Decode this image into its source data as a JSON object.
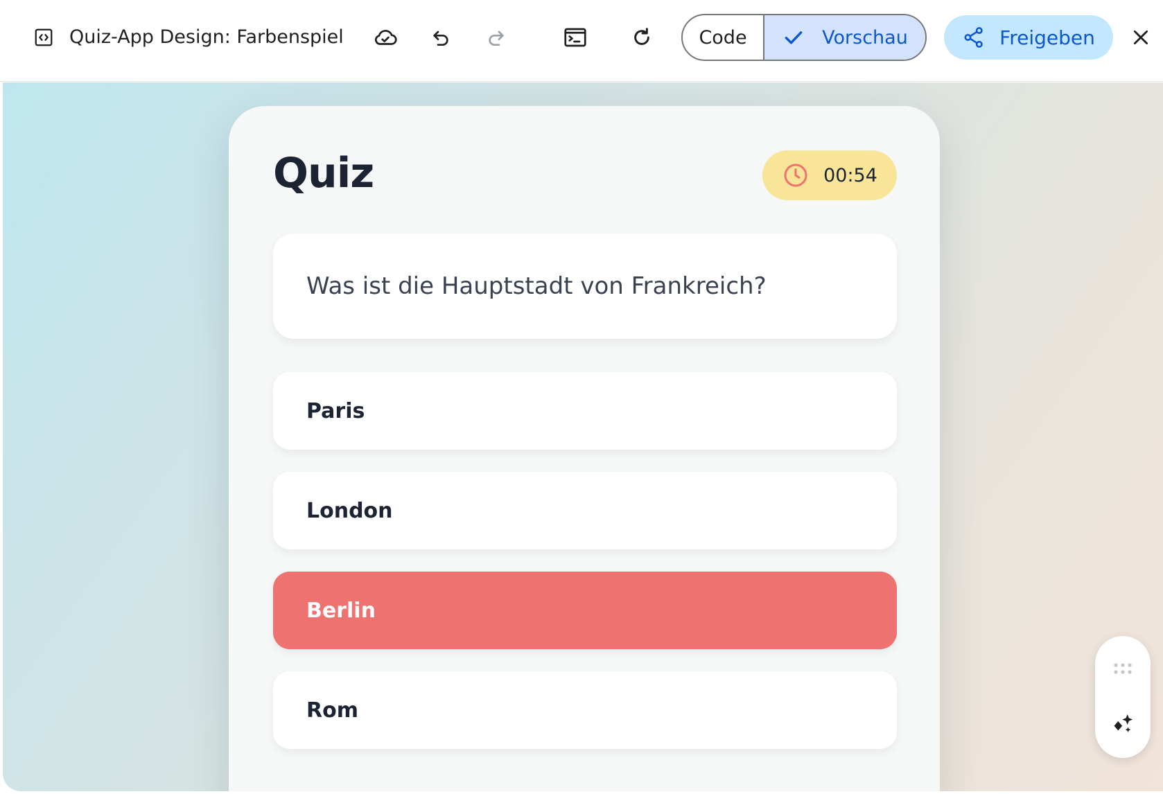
{
  "toolbar": {
    "app_icon": "code-file-icon",
    "title": "Quiz-App Design: Farbenspiel",
    "cloud_icon": "cloud-check-icon",
    "undo_icon": "undo-icon",
    "redo_icon": "redo-icon",
    "terminal_icon": "terminal-icon",
    "refresh_icon": "refresh-icon",
    "view_toggle": {
      "code_label": "Code",
      "preview_label": "Vorschau",
      "selected": "Vorschau"
    },
    "share_label": "Freigeben",
    "share_icon": "share-icon",
    "close_icon": "close-icon"
  },
  "quiz": {
    "title": "Quiz",
    "timer": "00:54",
    "timer_icon": "clock-icon",
    "question": "Was ist die Hauptstadt von Frankreich?",
    "answers": [
      {
        "label": "Paris",
        "state": "default"
      },
      {
        "label": "London",
        "state": "default"
      },
      {
        "label": "Berlin",
        "state": "wrong"
      },
      {
        "label": "Rom",
        "state": "default"
      }
    ]
  },
  "floating_panel": {
    "drag_icon": "drag-handle-icon",
    "ai_icon": "sparkle-icon"
  },
  "colors": {
    "preview_active": "#d3e3fd",
    "share_bg": "#c2e7ff",
    "accent_blue": "#0b57d0",
    "timer_bg": "#f8e598",
    "clock_icon": "#ee7370",
    "wrong_answer": "#ee7370",
    "text_dark": "#1c2333"
  }
}
